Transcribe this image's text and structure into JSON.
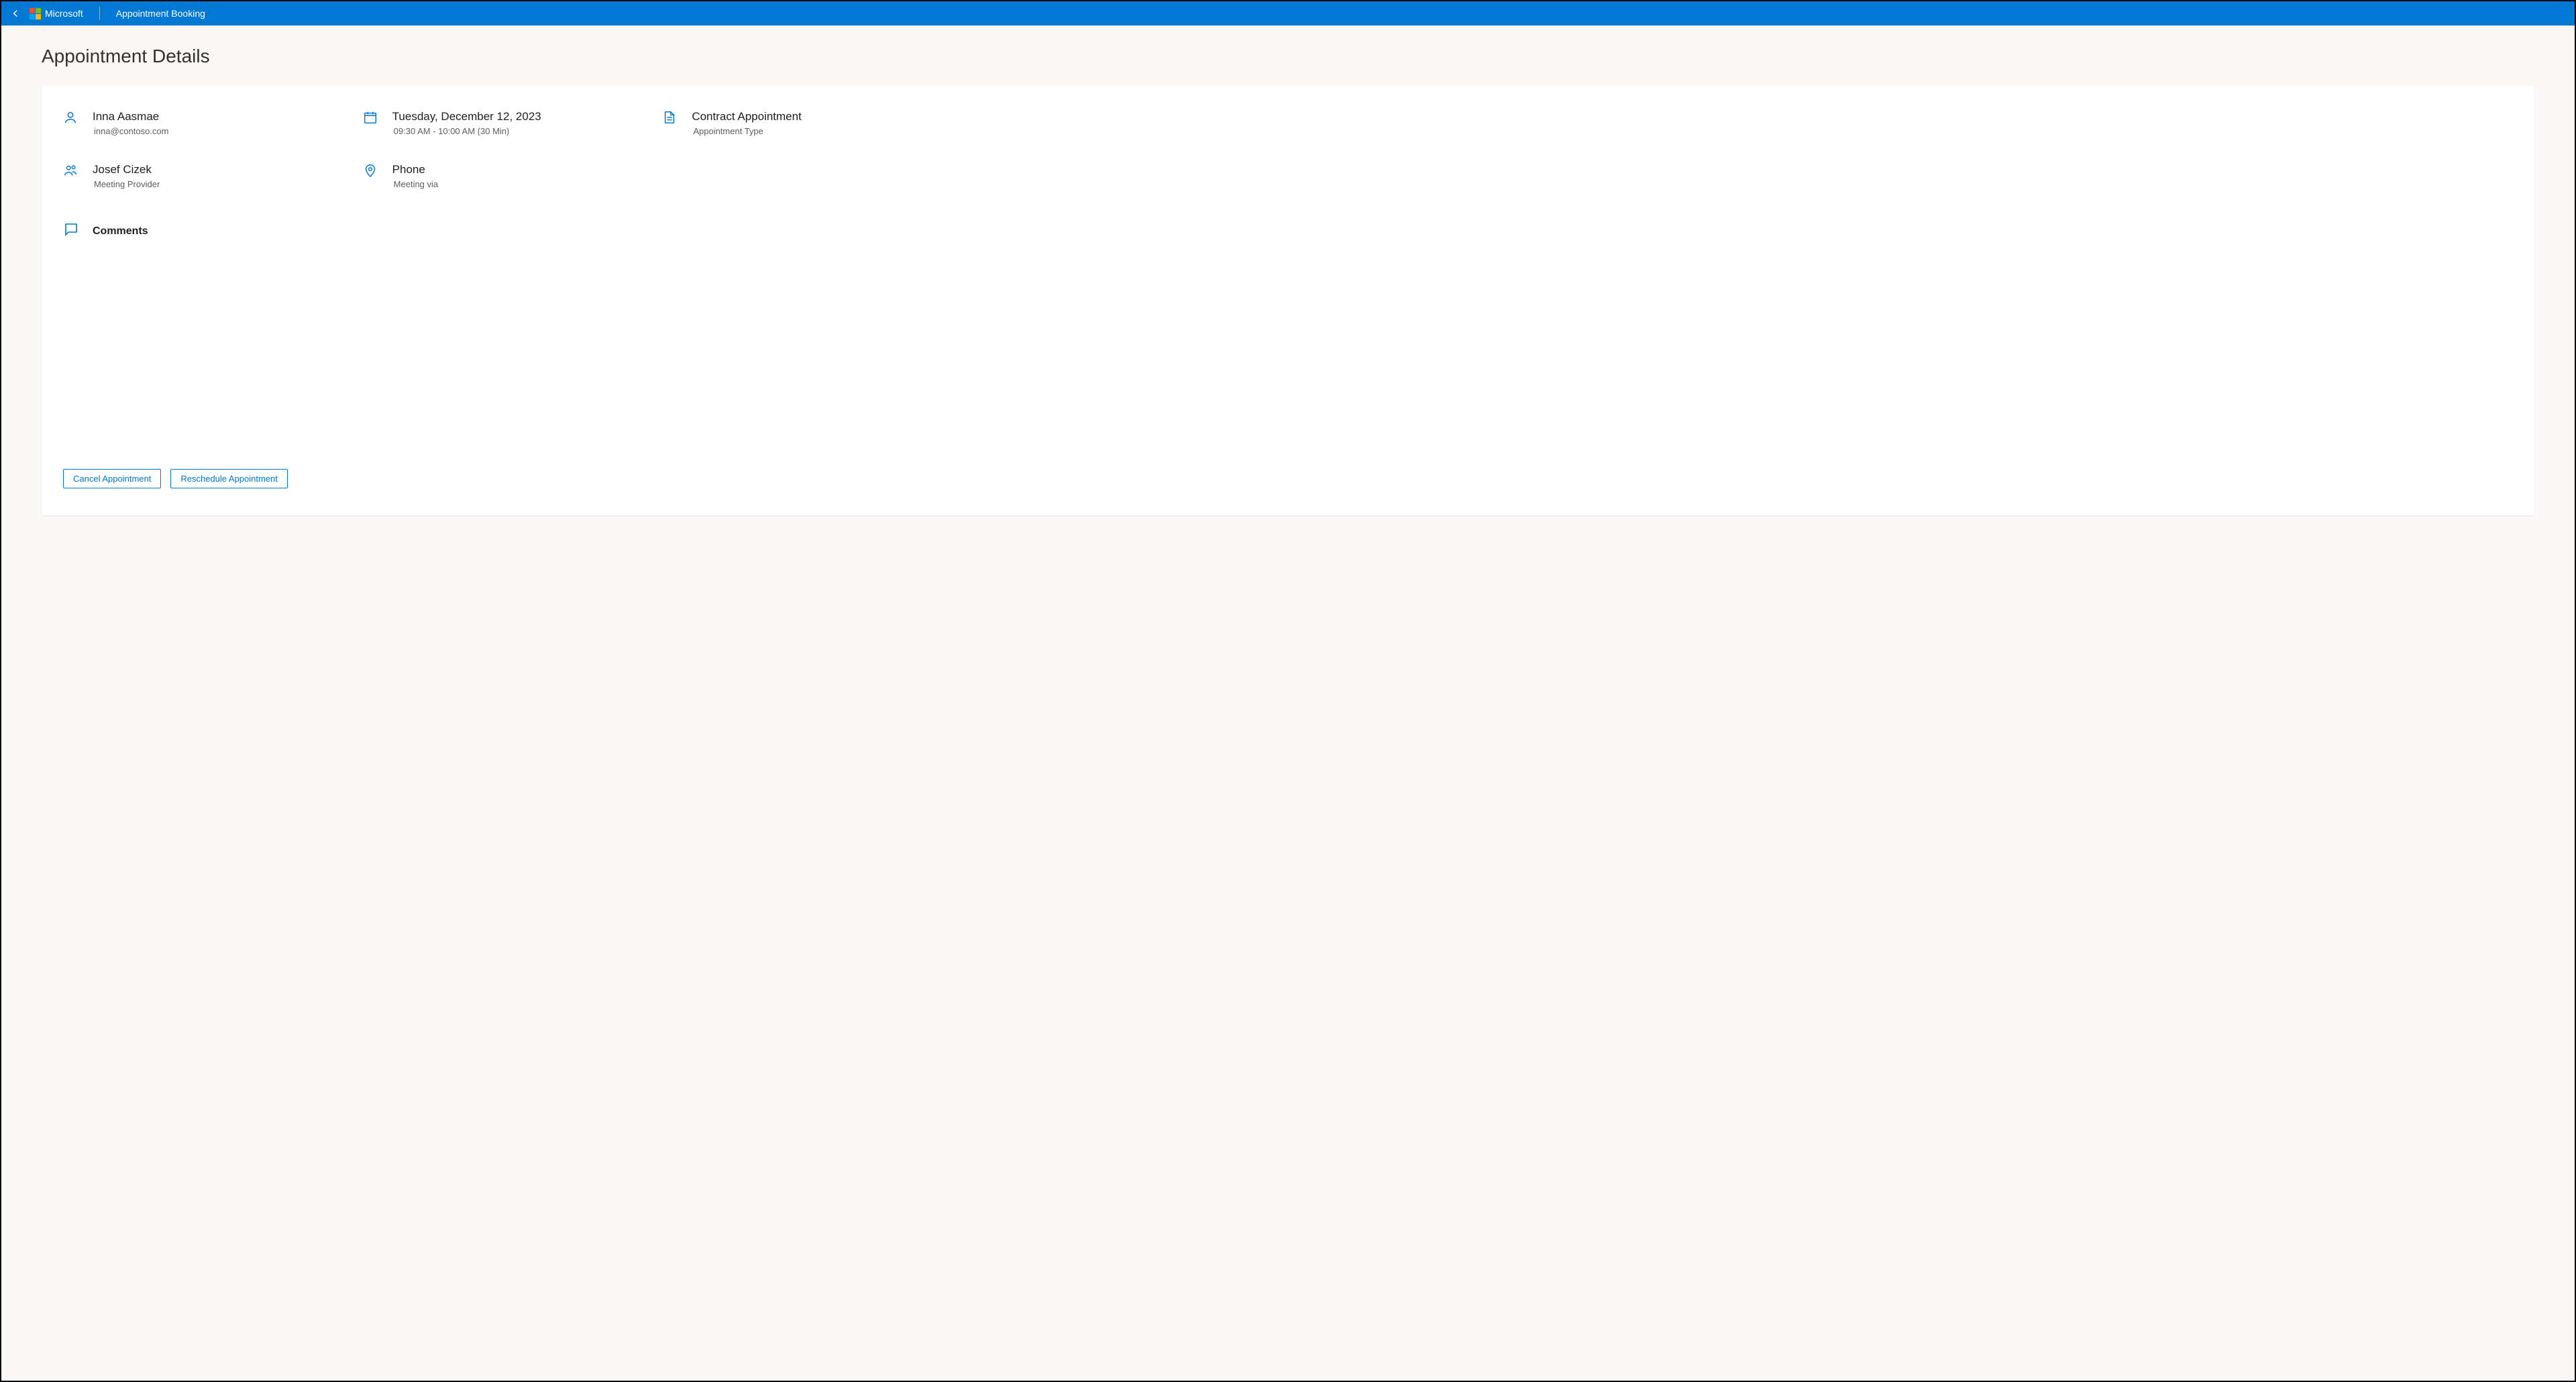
{
  "header": {
    "brand": "Microsoft",
    "page": "Appointment Booking"
  },
  "page_title": "Appointment Details",
  "attendee": {
    "name": "Inna Aasmae",
    "email": "inna@contoso.com"
  },
  "datetime": {
    "date": "Tuesday, December 12, 2023",
    "time": "09:30 AM - 10:00 AM (30 Min)"
  },
  "appointment_type": {
    "name": "Contract Appointment",
    "label": "Appointment Type"
  },
  "provider": {
    "name": "Josef Cizek",
    "role": "Meeting Provider"
  },
  "meeting_via": {
    "method": "Phone",
    "label": "Meeting via"
  },
  "comments": {
    "label": "Comments"
  },
  "actions": {
    "cancel": "Cancel Appointment",
    "reschedule": "Reschedule Appointment"
  }
}
